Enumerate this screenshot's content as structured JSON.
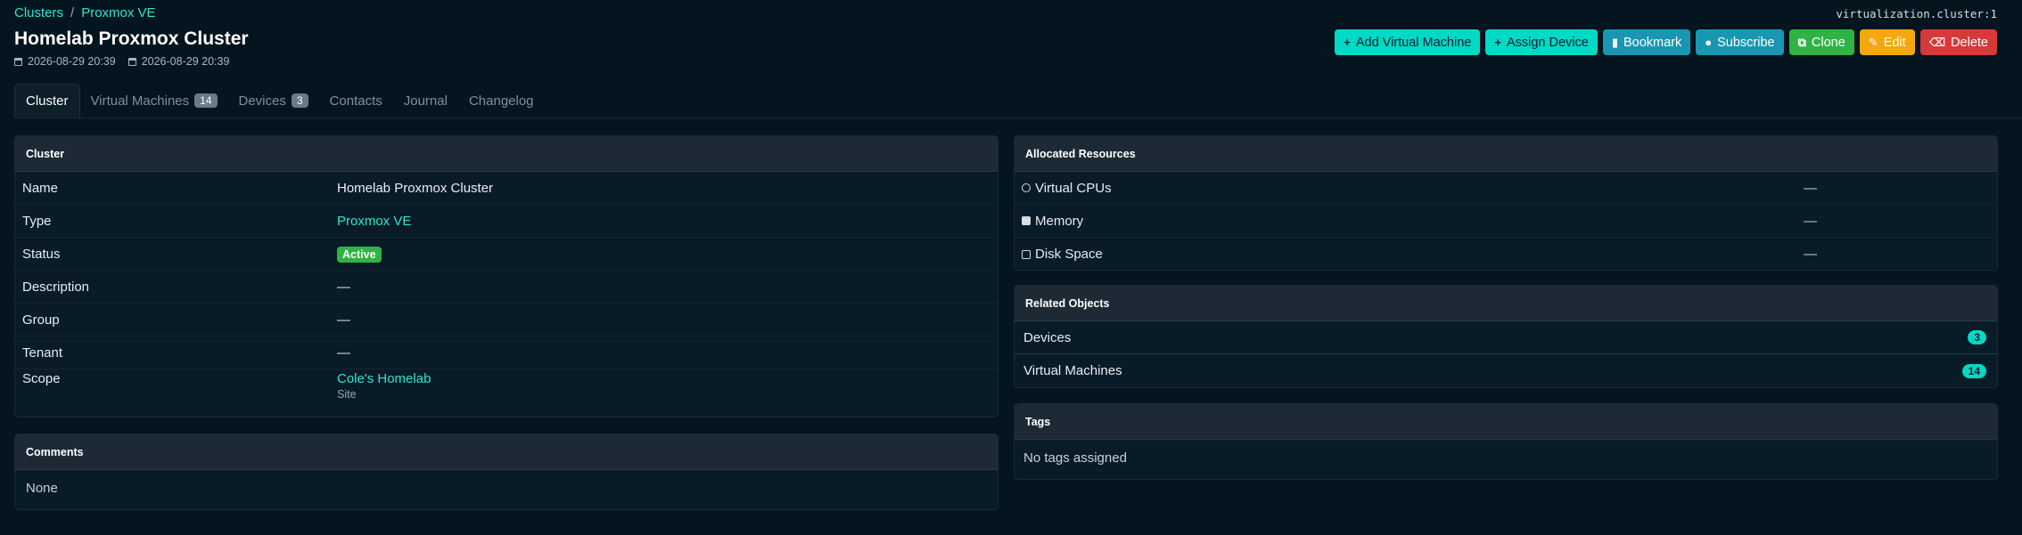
{
  "breadcrumb": {
    "parent": "Clusters",
    "separator": "/",
    "current": "Proxmox VE"
  },
  "object_id": "virtualization.cluster:1",
  "title": "Homelab Proxmox Cluster",
  "timestamps": {
    "created": "2026-08-29 20:39",
    "updated": "2026-08-29 20:39"
  },
  "actions": {
    "add_vm": "Add Virtual Machine",
    "assign_device": "Assign Device",
    "bookmark": "Bookmark",
    "subscribe": "Subscribe",
    "clone": "Clone",
    "edit": "Edit",
    "delete": "Delete"
  },
  "tabs": {
    "cluster": "Cluster",
    "vms": "Virtual Machines",
    "vms_count": "14",
    "devices": "Devices",
    "devices_count": "3",
    "contacts": "Contacts",
    "journal": "Journal",
    "changelog": "Changelog"
  },
  "cluster_card": {
    "header": "Cluster",
    "rows": {
      "name_label": "Name",
      "name_value": "Homelab Proxmox Cluster",
      "type_label": "Type",
      "type_value": "Proxmox VE",
      "status_label": "Status",
      "status_value": "Active",
      "description_label": "Description",
      "description_value": "—",
      "group_label": "Group",
      "group_value": "—",
      "tenant_label": "Tenant",
      "tenant_value": "—",
      "scope_label": "Scope",
      "scope_value": "Cole's Homelab",
      "scope_type": "Site"
    }
  },
  "comments_card": {
    "header": "Comments",
    "body": "None"
  },
  "resources_card": {
    "header": "Allocated Resources",
    "cpus_label": "Virtual CPUs",
    "cpus_value": "—",
    "memory_label": "Memory",
    "memory_value": "—",
    "disk_label": "Disk Space",
    "disk_value": "—"
  },
  "related_card": {
    "header": "Related Objects",
    "devices_label": "Devices",
    "devices_count": "3",
    "vms_label": "Virtual Machines",
    "vms_count": "14"
  },
  "tags_card": {
    "header": "Tags",
    "body": "No tags assigned"
  },
  "colors": {
    "accent": "#00d9c5",
    "background": "#04151f",
    "active": "#2fb344",
    "danger": "#d63939",
    "warning": "#f5a70f",
    "info": "#1997b2"
  }
}
